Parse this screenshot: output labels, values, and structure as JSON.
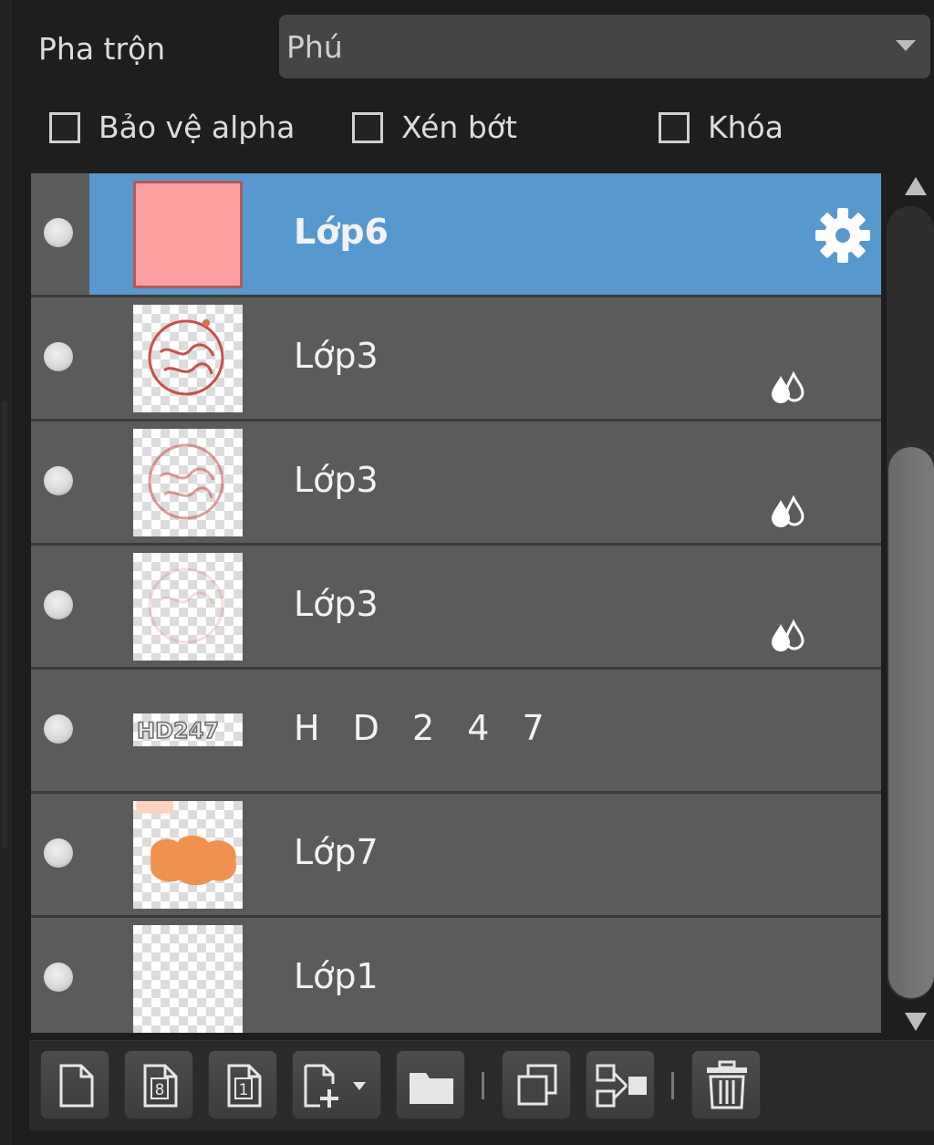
{
  "blend": {
    "label": "Pha trộn",
    "value": "Phú"
  },
  "checkboxes": [
    {
      "label": "Bảo vệ alpha",
      "checked": false
    },
    {
      "label": "Xén bớt",
      "checked": false
    },
    {
      "label": "Khóa",
      "checked": false
    }
  ],
  "layers": [
    {
      "name": "Lớp6",
      "selected": true,
      "thumbnail": "solid-pink",
      "icon": "gear-icon"
    },
    {
      "name": "Lớp3",
      "selected": false,
      "thumbnail": "red-stamp",
      "icon": "opacity-drops-icon"
    },
    {
      "name": "Lớp3",
      "selected": false,
      "thumbnail": "faded-red-stamp",
      "icon": "opacity-drops-icon"
    },
    {
      "name": "Lớp3",
      "selected": false,
      "thumbnail": "very-faded-stamp",
      "icon": "opacity-drops-icon"
    },
    {
      "name": "H D 2 4 7",
      "selected": false,
      "thumbnail": "text-strip"
    },
    {
      "name": "Lớp7",
      "selected": false,
      "thumbnail": "orange-blob"
    },
    {
      "name": "Lớp1",
      "selected": false,
      "thumbnail": "transparent"
    }
  ],
  "toolbar": {
    "buttons": [
      "new-layer-icon",
      "new-8bit-layer-icon",
      "new-1bit-layer-icon",
      "add-layer-menu-icon",
      "folder-icon",
      "duplicate-layer-icon",
      "merge-down-icon",
      "delete-icon"
    ],
    "badge_8": "8",
    "badge_1": "1"
  },
  "colors": {
    "selected": "#5799cf",
    "row": "#5b5b5b",
    "background": "#1e1e1e"
  }
}
